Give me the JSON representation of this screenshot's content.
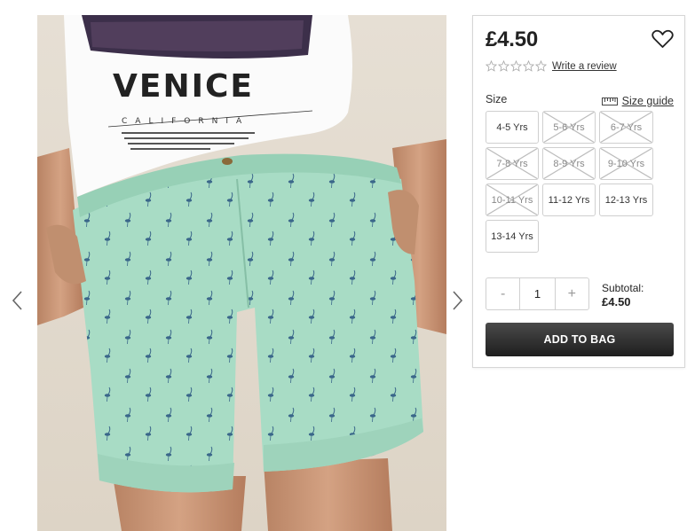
{
  "product": {
    "price": "£4.50",
    "review_link": "Write a review",
    "rating_stars": 0,
    "rating_max": 5
  },
  "image": {
    "alt": "Boys mint flamingo print chino shorts with Venice California t-shirt",
    "tee_text_main": "VENICE",
    "tee_text_sub": "CALIFORNIA"
  },
  "size": {
    "label": "Size",
    "guide_label": "Size guide",
    "options": [
      {
        "label": "4-5 Yrs",
        "available": true
      },
      {
        "label": "5-6 Yrs",
        "available": false
      },
      {
        "label": "6-7 Yrs",
        "available": false
      },
      {
        "label": "7-8 Yrs",
        "available": false
      },
      {
        "label": "8-9 Yrs",
        "available": false
      },
      {
        "label": "9-10 Yrs",
        "available": false
      },
      {
        "label": "10-11 Yrs",
        "available": false
      },
      {
        "label": "11-12 Yrs",
        "available": true
      },
      {
        "label": "12-13 Yrs",
        "available": true
      },
      {
        "label": "13-14 Yrs",
        "available": true
      }
    ]
  },
  "quantity": {
    "minus": "-",
    "value": "1",
    "plus": "+"
  },
  "subtotal": {
    "label": "Subtotal:",
    "amount": "£4.50"
  },
  "add_to_bag": "ADD TO BAG",
  "icons": {
    "prev": "chevron-left-icon",
    "next": "chevron-right-icon",
    "wishlist": "heart-icon",
    "star": "star-outline-icon",
    "size_guide": "ruler-icon"
  },
  "colors": {
    "button_dark": "#222222",
    "short_mint": "#a8dcc5",
    "flamingo": "#2e5a83"
  }
}
